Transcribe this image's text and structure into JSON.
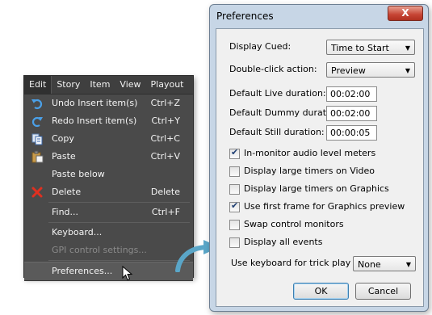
{
  "menubar": {
    "items": [
      "Edit",
      "Story",
      "Item",
      "View",
      "Playout"
    ]
  },
  "menu": {
    "items": [
      {
        "label": "Undo Insert item(s)",
        "shortcut": "Ctrl+Z",
        "icon": "undo-icon",
        "disabled": false
      },
      {
        "label": "Redo Insert item(s)",
        "shortcut": "Ctrl+Y",
        "icon": "redo-icon",
        "disabled": false
      },
      {
        "label": "Copy",
        "shortcut": "Ctrl+C",
        "icon": "copy-icon",
        "disabled": false
      },
      {
        "label": "Paste",
        "shortcut": "Ctrl+V",
        "icon": "paste-icon",
        "disabled": false
      },
      {
        "label": "Paste below",
        "shortcut": "",
        "icon": "",
        "disabled": false
      },
      {
        "label": "Delete",
        "shortcut": "Delete",
        "icon": "delete-icon",
        "disabled": false
      },
      {
        "label": "Find...",
        "shortcut": "Ctrl+F",
        "icon": "",
        "disabled": false
      },
      {
        "label": "Keyboard...",
        "shortcut": "",
        "icon": "",
        "disabled": false
      },
      {
        "label": "GPI control settings...",
        "shortcut": "",
        "icon": "",
        "disabled": true
      },
      {
        "label": "Preferences...",
        "shortcut": "",
        "icon": "",
        "disabled": false
      }
    ]
  },
  "dialog": {
    "title": "Preferences",
    "close_label": "X",
    "display_cued": {
      "label": "Display Cued:",
      "value": "Time to Start"
    },
    "double_click": {
      "label": "Double-click action:",
      "value": "Preview"
    },
    "live_duration": {
      "label": "Default Live duration:",
      "value": "00:02:00"
    },
    "dummy_duration": {
      "label": "Default Dummy duration:",
      "value": "00:02:00"
    },
    "still_duration": {
      "label": "Default Still duration:",
      "value": "00:00:05"
    },
    "checkboxes": [
      {
        "label": "In-monitor audio level meters",
        "checked": true
      },
      {
        "label": "Display large timers on Video",
        "checked": false
      },
      {
        "label": "Display large timers on Graphics",
        "checked": false
      },
      {
        "label": "Use first frame for Graphics preview",
        "checked": true
      },
      {
        "label": "Swap control monitors",
        "checked": false
      },
      {
        "label": "Display all events",
        "checked": false
      }
    ],
    "trick_play": {
      "label": "Use keyboard for trick play on:",
      "value": "None"
    },
    "ok_label": "OK",
    "cancel_label": "Cancel"
  }
}
